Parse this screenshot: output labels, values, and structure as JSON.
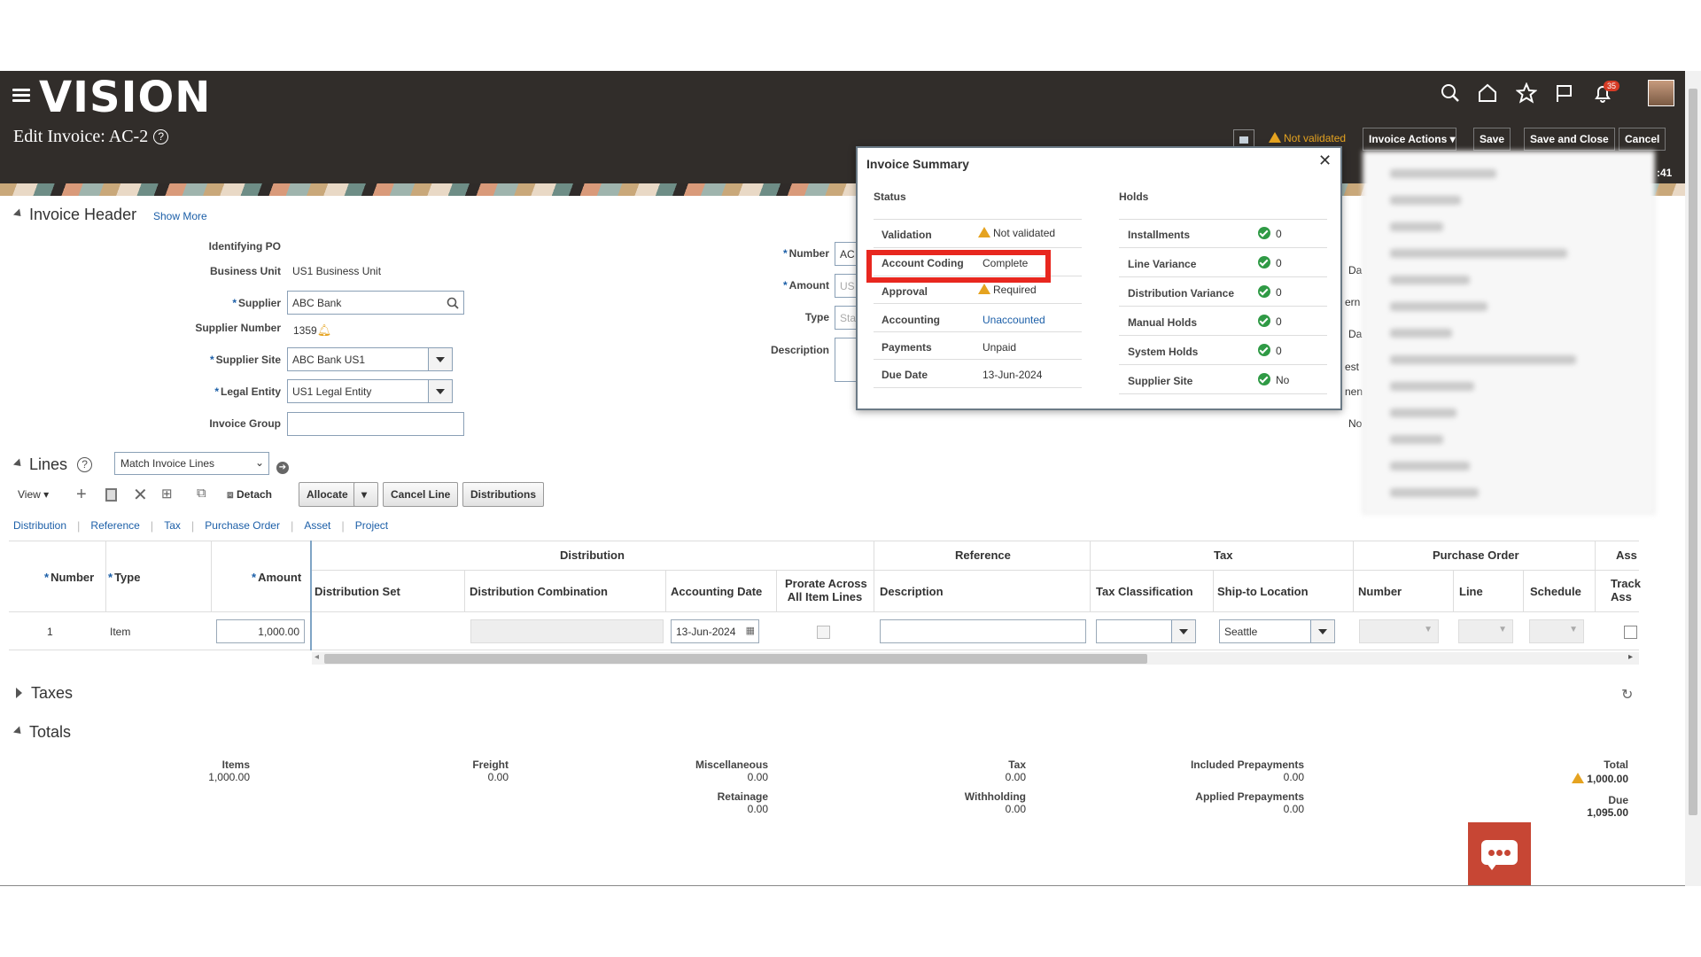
{
  "app": {
    "logo": "Vision",
    "page_title": "Edit Invoice: AC-2",
    "help": "?"
  },
  "topbar": {
    "notification_count": "35",
    "status_label": "Not validated",
    "invoice_actions": "Invoice Actions",
    "save": "Save",
    "save_and_close": "Save and Close",
    "cancel": "Cancel",
    "time_fragment": ":41"
  },
  "header": {
    "section_title": "Invoice Header",
    "show_more": "Show More",
    "identifying_po_label": "Identifying PO",
    "business_unit_label": "Business Unit",
    "business_unit_value": "US1 Business Unit",
    "supplier_label": "Supplier",
    "supplier_value": "ABC Bank",
    "supplier_number_label": "Supplier Number",
    "supplier_number_value": "1359",
    "supplier_site_label": "Supplier Site",
    "supplier_site_value": "ABC Bank US1",
    "legal_entity_label": "Legal Entity",
    "legal_entity_value": "US1 Legal Entity",
    "invoice_group_label": "Invoice Group",
    "number_label": "Number",
    "number_value": "AC",
    "amount_label": "Amount",
    "amount_value": "US",
    "type_label": "Type",
    "type_value": "Sta",
    "description_label": "Description",
    "right_cut_labels": [
      "Da",
      "ern",
      "Da",
      "est",
      "nen",
      "No"
    ]
  },
  "lines": {
    "section_title": "Lines",
    "match_select": "Match Invoice Lines",
    "view": "View",
    "detach": "Detach",
    "allocate": "Allocate",
    "cancel_line": "Cancel Line",
    "distributions": "Distributions",
    "tabs": [
      "Distribution",
      "Reference",
      "Tax",
      "Purchase Order",
      "Asset",
      "Project"
    ],
    "group_headers": {
      "distribution": "Distribution",
      "reference": "Reference",
      "tax": "Tax",
      "purchase_order": "Purchase Order",
      "asset": "Ass"
    },
    "columns": {
      "number": "Number",
      "type": "Type",
      "amount": "Amount",
      "distribution_set": "Distribution Set",
      "distribution_combination": "Distribution Combination",
      "accounting_date": "Accounting Date",
      "prorate_line1": "Prorate Across",
      "prorate_line2": "All Item Lines",
      "description": "Description",
      "tax_classification": "Tax Classification",
      "ship_to_location": "Ship-to Location",
      "po_number": "Number",
      "po_line": "Line",
      "po_schedule": "Schedule",
      "track_line1": "Track",
      "track_line2": "Ass"
    },
    "row": {
      "number": "1",
      "type": "Item",
      "amount": "1,000.00",
      "accounting_date": "13-Jun-2024",
      "ship_to_location": "Seattle"
    }
  },
  "taxes": {
    "section_title": "Taxes"
  },
  "totals": {
    "section_title": "Totals",
    "items_label": "Items",
    "items_value": "1,000.00",
    "freight_label": "Freight",
    "freight_value": "0.00",
    "misc_label": "Miscellaneous",
    "misc_value": "0.00",
    "retainage_label": "Retainage",
    "retainage_value": "0.00",
    "tax_label": "Tax",
    "tax_value": "0.00",
    "withholding_label": "Withholding",
    "withholding_value": "0.00",
    "included_prepay_label": "Included Prepayments",
    "included_prepay_value": "0.00",
    "applied_prepay_label": "Applied Prepayments",
    "applied_prepay_value": "0.00",
    "total_label": "Total",
    "total_value": "1,000.00",
    "due_label": "Due",
    "due_value": "1,095.00"
  },
  "summary": {
    "title": "Invoice Summary",
    "status_heading": "Status",
    "holds_heading": "Holds",
    "status_rows": [
      {
        "label": "Validation",
        "value": "Not validated"
      },
      {
        "label": "Account Coding",
        "value": "Complete"
      },
      {
        "label": "Approval",
        "value": "Required"
      },
      {
        "label": "Accounting",
        "value": "Unaccounted"
      },
      {
        "label": "Payments",
        "value": "Unpaid"
      },
      {
        "label": "Due Date",
        "value": "13-Jun-2024"
      }
    ],
    "hold_rows": [
      {
        "label": "Installments",
        "value": "0"
      },
      {
        "label": "Line Variance",
        "value": "0"
      },
      {
        "label": "Distribution Variance",
        "value": "0"
      },
      {
        "label": "Manual Holds",
        "value": "0"
      },
      {
        "label": "System Holds",
        "value": "0"
      },
      {
        "label": "Supplier Site",
        "value": "No"
      }
    ]
  },
  "colors": {
    "brand_dark": "#312d2a",
    "accent_red": "#c74634",
    "link": "#1c5fa8",
    "highlight": "#e8271f",
    "ok_green": "#2f9a45",
    "warn": "#e5a320"
  }
}
